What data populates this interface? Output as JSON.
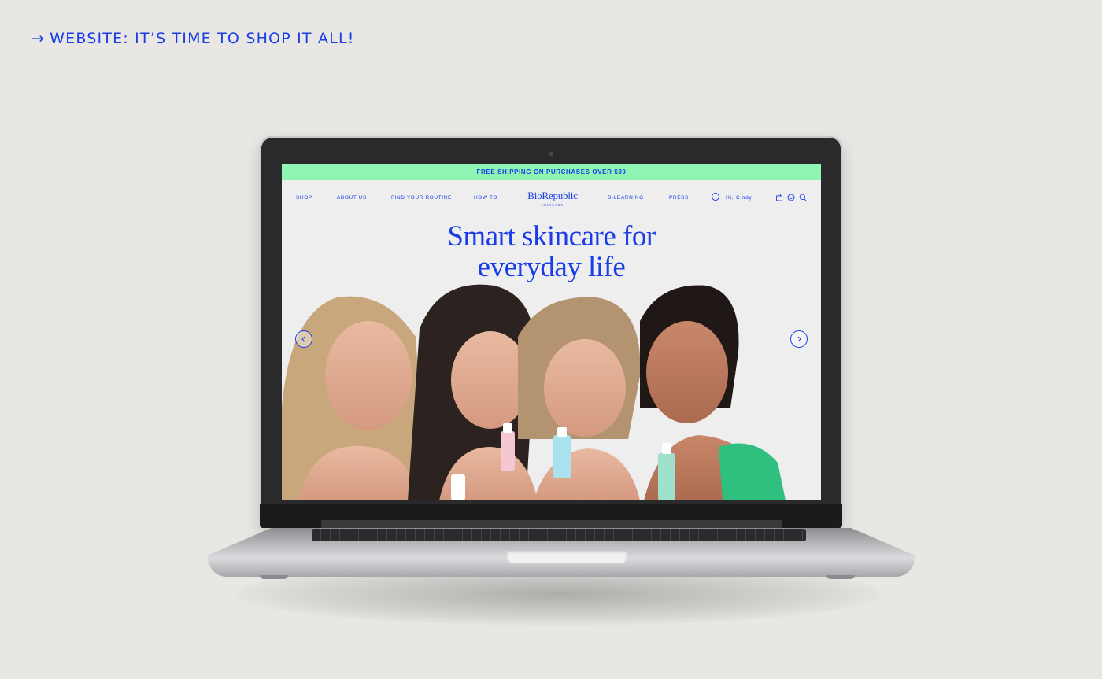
{
  "caption": {
    "arrow": "→",
    "text": "WEBSITE: IT’S TIME TO SHOP IT ALL!"
  },
  "site": {
    "banner": "FREE SHIPPING ON PURCHASES OVER $30",
    "nav": {
      "left": [
        "SHOP",
        "ABOUT US",
        "FIND YOUR ROUTINE",
        "HOW TO"
      ],
      "right": [
        "B-LEARNING",
        "PRESS"
      ],
      "greeting": "Hi, Cindy"
    },
    "logo": {
      "name": "BioRepublic",
      "tagline": "SKINCARE"
    },
    "hero": {
      "title_line1": "Smart skincare for",
      "title_line2": "everyday life"
    },
    "icons": {
      "user": "user-icon",
      "bag": "bag-icon",
      "face": "face-icon",
      "search": "search-icon",
      "prev": "chevron-left-icon",
      "next": "chevron-right-icon"
    }
  },
  "colors": {
    "brand_blue": "#1a3de8",
    "banner_green": "#8ef5b3",
    "page_bg": "#e8e7e4"
  }
}
